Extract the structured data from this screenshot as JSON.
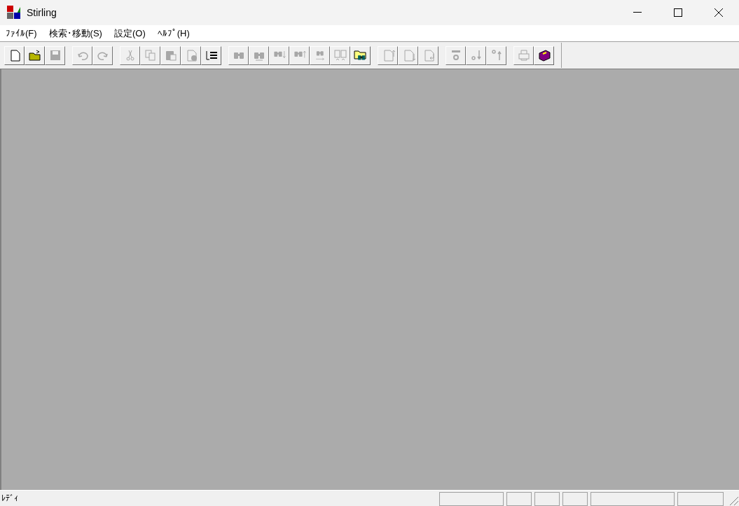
{
  "window": {
    "title": "Stirling"
  },
  "menu": [
    {
      "label": "ﾌｧｲﾙ(F)"
    },
    {
      "label": "検索･移動(S)"
    },
    {
      "label": "設定(O)"
    },
    {
      "label": "ﾍﾙﾌﾟ(H)"
    }
  ],
  "toolbar": [
    [
      {
        "kind": "new",
        "disabled": false
      },
      {
        "kind": "open",
        "disabled": false
      },
      {
        "kind": "save",
        "disabled": true
      }
    ],
    [
      {
        "kind": "undo",
        "disabled": true
      },
      {
        "kind": "redo",
        "disabled": true
      }
    ],
    [
      {
        "kind": "cut",
        "disabled": true
      },
      {
        "kind": "copy",
        "disabled": true
      },
      {
        "kind": "paste",
        "disabled": true
      },
      {
        "kind": "delete",
        "disabled": true
      },
      {
        "kind": "list",
        "disabled": false
      }
    ],
    [
      {
        "kind": "find",
        "disabled": true
      },
      {
        "kind": "replace",
        "disabled": true
      },
      {
        "kind": "finddown",
        "disabled": true
      },
      {
        "kind": "findup",
        "disabled": true
      },
      {
        "kind": "compare",
        "disabled": true
      },
      {
        "kind": "pages",
        "disabled": true
      },
      {
        "kind": "folderfind",
        "disabled": false
      }
    ],
    [
      {
        "kind": "pageup",
        "disabled": true
      },
      {
        "kind": "pagedown",
        "disabled": true
      },
      {
        "kind": "pagejump",
        "disabled": true
      }
    ],
    [
      {
        "kind": "mark",
        "disabled": true
      },
      {
        "kind": "markdown",
        "disabled": true
      },
      {
        "kind": "markup",
        "disabled": true
      }
    ],
    [
      {
        "kind": "print",
        "disabled": true
      },
      {
        "kind": "help",
        "disabled": false
      }
    ]
  ],
  "status_bar": {
    "message": "ﾚﾃﾞｨ"
  }
}
